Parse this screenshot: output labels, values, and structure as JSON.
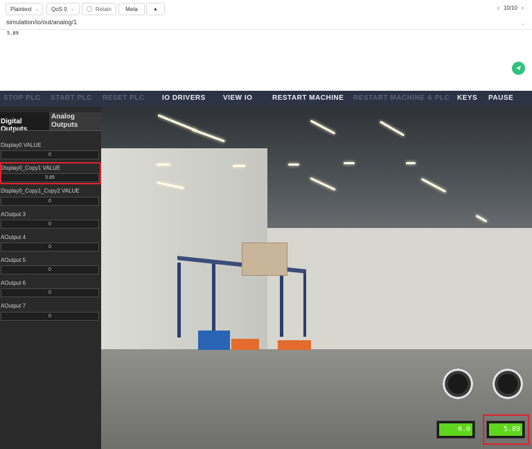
{
  "publish": {
    "format_label": "Plaintext",
    "qos_label": "QoS 0",
    "retain_label": "Retain",
    "meta_label": "Meta",
    "expand_icon": "caret-up-icon",
    "pager": "10/10",
    "topic": "simulation/io/out/analog/1",
    "payload": "5.89",
    "send_color": "#2ec27e"
  },
  "menu": {
    "items": [
      {
        "label": "STOP PLC",
        "enabled": false
      },
      {
        "label": "START PLC",
        "enabled": false
      },
      {
        "label": "RESET PLC",
        "enabled": false
      },
      {
        "label": "IO DRIVERS",
        "enabled": true
      },
      {
        "label": "VIEW IO",
        "enabled": true
      },
      {
        "label": "RESTART MACHINE",
        "enabled": true
      },
      {
        "label": "RESTART MACHINE & PLC",
        "enabled": false
      },
      {
        "label": "KEYS",
        "enabled": true
      },
      {
        "label": "PAUSE",
        "enabled": true
      }
    ]
  },
  "panel": {
    "tabs": {
      "active": "Digital Outputs",
      "inactive": "Analog Outputs"
    },
    "fields": [
      {
        "label": "Display0 VALUE",
        "value": "0"
      },
      {
        "label": "Display0_Copy1 VALUE",
        "value": "5.89"
      },
      {
        "label": "Display0_Copy1_Copy2 VALUE",
        "value": "0"
      },
      {
        "label": "AOutput 3",
        "value": "0"
      },
      {
        "label": "AOutput 4",
        "value": "0"
      },
      {
        "label": "AOutput 5",
        "value": "0"
      },
      {
        "label": "AOutput 6",
        "value": "0"
      },
      {
        "label": "AOutput 7",
        "value": "0"
      }
    ]
  },
  "scene": {
    "display_left": "0.0",
    "display_right": "5.89",
    "highlight_color": "#e0222c",
    "lcd_color": "#5fd61e"
  }
}
